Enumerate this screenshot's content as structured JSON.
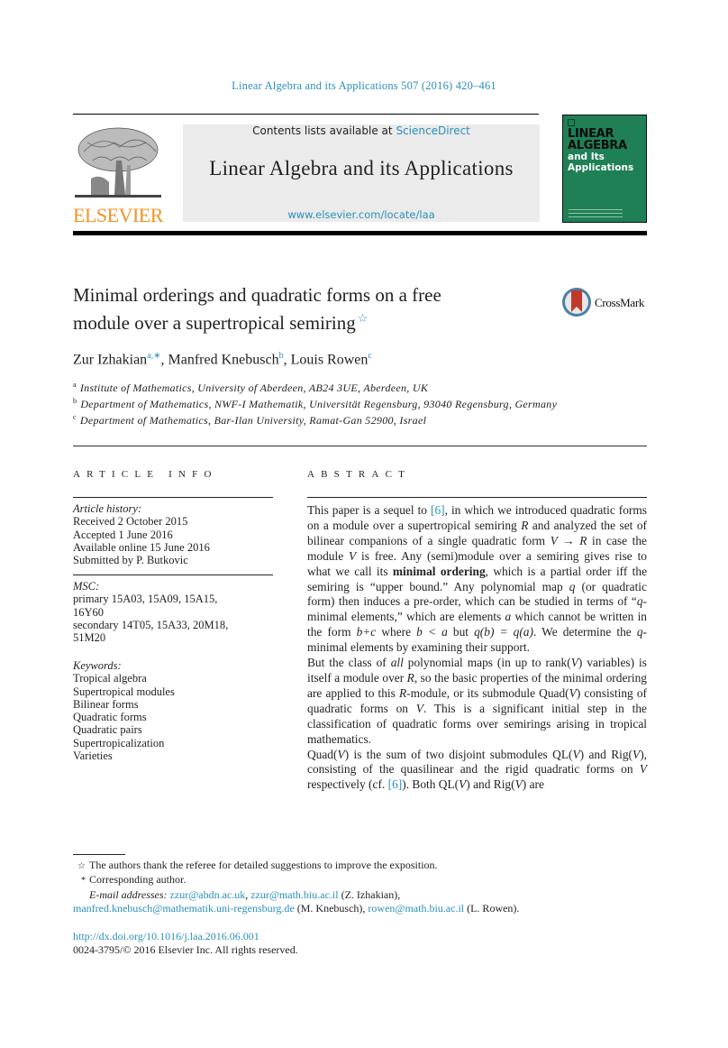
{
  "running_head": "Linear Algebra and its Applications 507 (2016) 420–461",
  "masthead": {
    "publisher_name": "ELSEVIER",
    "contents_prefix": "Contents lists available at ",
    "contents_link": "ScienceDirect",
    "journal_title": "Linear Algebra and its Applications",
    "journal_url": "www.elsevier.com/locate/laa",
    "cover": {
      "title_line1": "LINEAR",
      "title_line2": "ALGEBRA",
      "sub_line1": "and Its",
      "sub_line2": "Applications",
      "color": "#1f7f55"
    }
  },
  "article": {
    "title_line1": "Minimal orderings and quadratic forms on a free",
    "title_line2": "module over a supertropical semiring",
    "title_mark": "☆",
    "crossmark_label": "CrossMark",
    "authors": [
      {
        "name": "Zur Izhakian",
        "marks": "a,∗"
      },
      {
        "name": "Manfred Knebusch",
        "marks": "b"
      },
      {
        "name": "Louis Rowen",
        "marks": "c"
      }
    ],
    "affiliations": [
      {
        "mark": "a",
        "text": "Institute of Mathematics, University of Aberdeen, AB24 3UE, Aberdeen, UK"
      },
      {
        "mark": "b",
        "text": "Department of Mathematics, NWF-I Mathematik, Universität Regensburg, 93040 Regensburg, Germany"
      },
      {
        "mark": "c",
        "text": "Department of Mathematics, Bar-Ilan University, Ramat-Gan 52900, Israel"
      }
    ]
  },
  "article_info": {
    "heading": "ARTICLE INFO",
    "history_label": "Article history:",
    "history": [
      "Received 2 October 2015",
      "Accepted 1 June 2016",
      "Available online 15 June 2016",
      "Submitted by P. Butkovic"
    ],
    "msc_label": "MSC:",
    "msc": [
      "primary 15A03, 15A09, 15A15,",
      "16Y60",
      "secondary 14T05, 15A33, 20M18,",
      "51M20"
    ],
    "keywords_label": "Keywords:",
    "keywords": [
      "Tropical algebra",
      "Supertropical modules",
      "Bilinear forms",
      "Quadratic forms",
      "Quadratic pairs",
      "Supertropicalization",
      "Varieties"
    ]
  },
  "abstract": {
    "heading": "ABSTRACT",
    "p1_a": "This paper is a sequel to ",
    "ref": "[6]",
    "p1_b": ", in which we introduced quadratic forms on a module over a supertropical semiring ",
    "p1_R": "R",
    "p1_c": " and analyzed the set of bilinear companions of a single quadratic form ",
    "p1_VR": "V → R",
    "p1_d": " in case the module ",
    "p1_V": "V",
    "p1_e": " is free. Any (semi)module over a semiring gives rise to what we call its ",
    "p1_bold": "minimal ordering",
    "p1_f": ", which is a partial order iff the semiring is “upper bound.” Any polynomial map ",
    "p1_q": "q",
    "p1_g": " (or quadratic form) then induces a pre-order, which can be studied in terms of “",
    "p1_q2": "q",
    "p1_h": "-minimal elements,” which are elements ",
    "p1_a_var": "a",
    "p1_i": " which cannot be written in the form ",
    "p1_bc": "b+c",
    "p1_j": " where ",
    "p1_ba": "b < a",
    "p1_k": " but ",
    "p1_qbqa": "q(b) = q(a)",
    "p1_l": ". We determine the ",
    "p1_q3": "q",
    "p1_m": "-minimal elements by examining their support.",
    "p2_a": "But the class of ",
    "p2_all": "all",
    "p2_b": " polynomial maps (in up to rank(",
    "p2_V": "V",
    "p2_c": ") variables) is itself a module over ",
    "p2_R": "R",
    "p2_d": ", so the basic properties of the minimal ordering are applied to this ",
    "p2_R2": "R",
    "p2_e": "-module, or its submodule Quad(",
    "p2_V2": "V",
    "p2_f": ") consisting of quadratic forms on ",
    "p2_V3": "V",
    "p2_g": ". This is a significant initial step in the classification of quadratic forms over semirings arising in tropical mathematics.",
    "p3_a": "Quad(",
    "p3_V": "V",
    "p3_b": ") is the sum of two disjoint submodules QL(",
    "p3_V2": "V",
    "p3_c": ") and Rig(",
    "p3_V3": "V",
    "p3_d": "), consisting of the quasilinear and the rigid quadratic forms on ",
    "p3_V4": "V",
    "p3_e": " respectively (cf. ",
    "p3_ref": "[6]",
    "p3_f": "). Both QL(",
    "p3_V5": "V",
    "p3_g": ") and Rig(",
    "p3_V6": "V",
    "p3_h": ") are"
  },
  "footnotes": {
    "star_mark": "☆",
    "star_text": "The authors thank the referee for detailed suggestions to improve the exposition.",
    "corr_mark": "*",
    "corr_text": "Corresponding author.",
    "email_label": "E-mail addresses:",
    "emails": [
      {
        "address": "zzur@abdn.ac.uk",
        "after": ", "
      },
      {
        "address": "zzur@math.biu.ac.il",
        "after": " (Z. Izhakian),"
      },
      {
        "address": "manfred.knebusch@mathematik.uni-regensburg.de",
        "after": " (M. Knebusch), "
      },
      {
        "address": "rowen@math.biu.ac.il",
        "after": " (L. Rowen)."
      }
    ]
  },
  "doi": "http://dx.doi.org/10.1016/j.laa.2016.06.001",
  "copyright": "0024-3795/© 2016 Elsevier Inc. All rights reserved.",
  "colors": {
    "link": "#2a8fb8",
    "elsevier_orange": "#f39323",
    "cover_green": "#1f7f55",
    "masthead_gray": "#ebebeb"
  }
}
